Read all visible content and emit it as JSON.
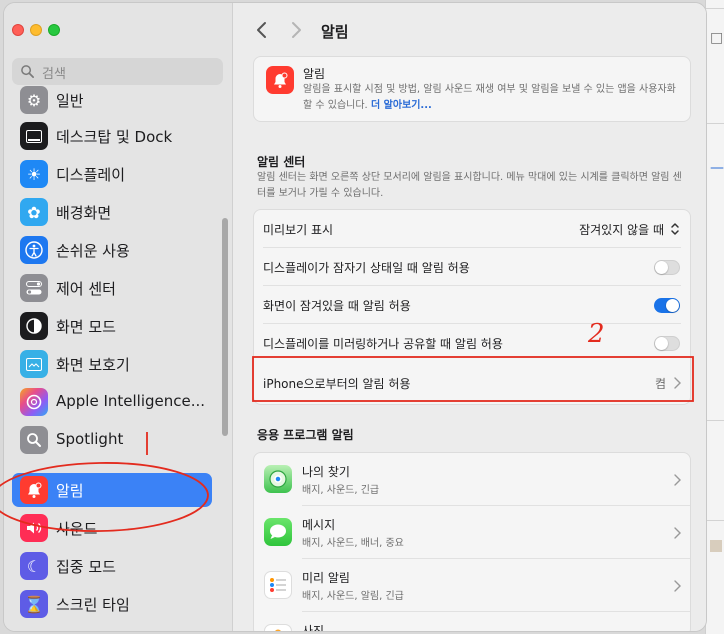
{
  "search": {
    "placeholder": "검색"
  },
  "sidebar": {
    "items": [
      {
        "label": "일반",
        "icon": "gear-icon",
        "color": "#8e8e93"
      },
      {
        "label": "데스크탑 및 Dock",
        "icon": "desktop-dock-icon",
        "color": "#1c1c1e"
      },
      {
        "label": "디스플레이",
        "icon": "sun-icon",
        "color": "#1e88f5"
      },
      {
        "label": "배경화면",
        "icon": "flower-icon",
        "color": "#30a8f0"
      },
      {
        "label": "손쉬운 사용",
        "icon": "accessibility-icon",
        "color": "#1e78f0"
      },
      {
        "label": "제어 센터",
        "icon": "control-center-icon",
        "color": "#8e8e93"
      },
      {
        "label": "화면 모드",
        "icon": "appearance-icon",
        "color": "#1c1c1e"
      },
      {
        "label": "화면 보호기",
        "icon": "screensaver-icon",
        "color": "#37b0e6"
      },
      {
        "label": "Apple Intelligence...",
        "icon": "apple-intelligence-icon",
        "color": "#e84d8a"
      },
      {
        "label": "Spotlight",
        "icon": "spotlight-icon",
        "color": "#8e8e93"
      },
      {
        "label": "알림",
        "icon": "notification-bell-icon",
        "color": "#ff3b30",
        "selected": true
      },
      {
        "label": "사운드",
        "icon": "speaker-icon",
        "color": "#ff2d55"
      },
      {
        "label": "집중 모드",
        "icon": "moon-icon",
        "color": "#5e5ce6"
      },
      {
        "label": "스크린 타임",
        "icon": "hourglass-icon",
        "color": "#5e5ce6"
      }
    ]
  },
  "header": {
    "title": "알림"
  },
  "hero": {
    "title": "알림",
    "description": "알림을 표시할 시점 및 방법, 알림 사운드 재생 여부 및 알림을 보낼 수 있는 앱을 사용자화할 수 있습니다.",
    "link": "더 알아보기..."
  },
  "notification_center": {
    "title": "알림 센터",
    "description": "알림 센터는 화면 오른쪽 상단 모서리에 알림을 표시합니다. 메뉴 막대에 있는 시계를 클릭하면 알림 센터를 보거나 가릴 수 있습니다.",
    "preview": {
      "label": "미리보기 표시",
      "value": "잠겨있지 않을 때"
    },
    "toggles": [
      {
        "label": "디스플레이가 잠자기 상태일 때 알림 허용",
        "on": false
      },
      {
        "label": "화면이 잠겨있을 때 알림 허용",
        "on": true
      },
      {
        "label": "디스플레이를 미러링하거나 공유할 때 알림 허용",
        "on": false
      }
    ],
    "iphone": {
      "label": "iPhone으로부터의 알림 허용",
      "value": "켬"
    }
  },
  "app_notifications": {
    "title": "응용 프로그램 알림",
    "apps": [
      {
        "name": "나의 찾기",
        "detail": "배지, 사운드, 긴급",
        "icon": "find-my-icon"
      },
      {
        "name": "메시지",
        "detail": "배지, 사운드, 배너, 중요",
        "icon": "messages-icon"
      },
      {
        "name": "미리 알림",
        "detail": "배지, 사운드, 알림, 긴급",
        "icon": "reminders-icon"
      },
      {
        "name": "사진",
        "detail": "",
        "icon": "photos-icon"
      }
    ]
  },
  "annotations": {
    "number": "2"
  },
  "colors": {
    "accent": "#3b82f6",
    "annotation": "#e32b1e",
    "notification": "#ff3b30"
  }
}
